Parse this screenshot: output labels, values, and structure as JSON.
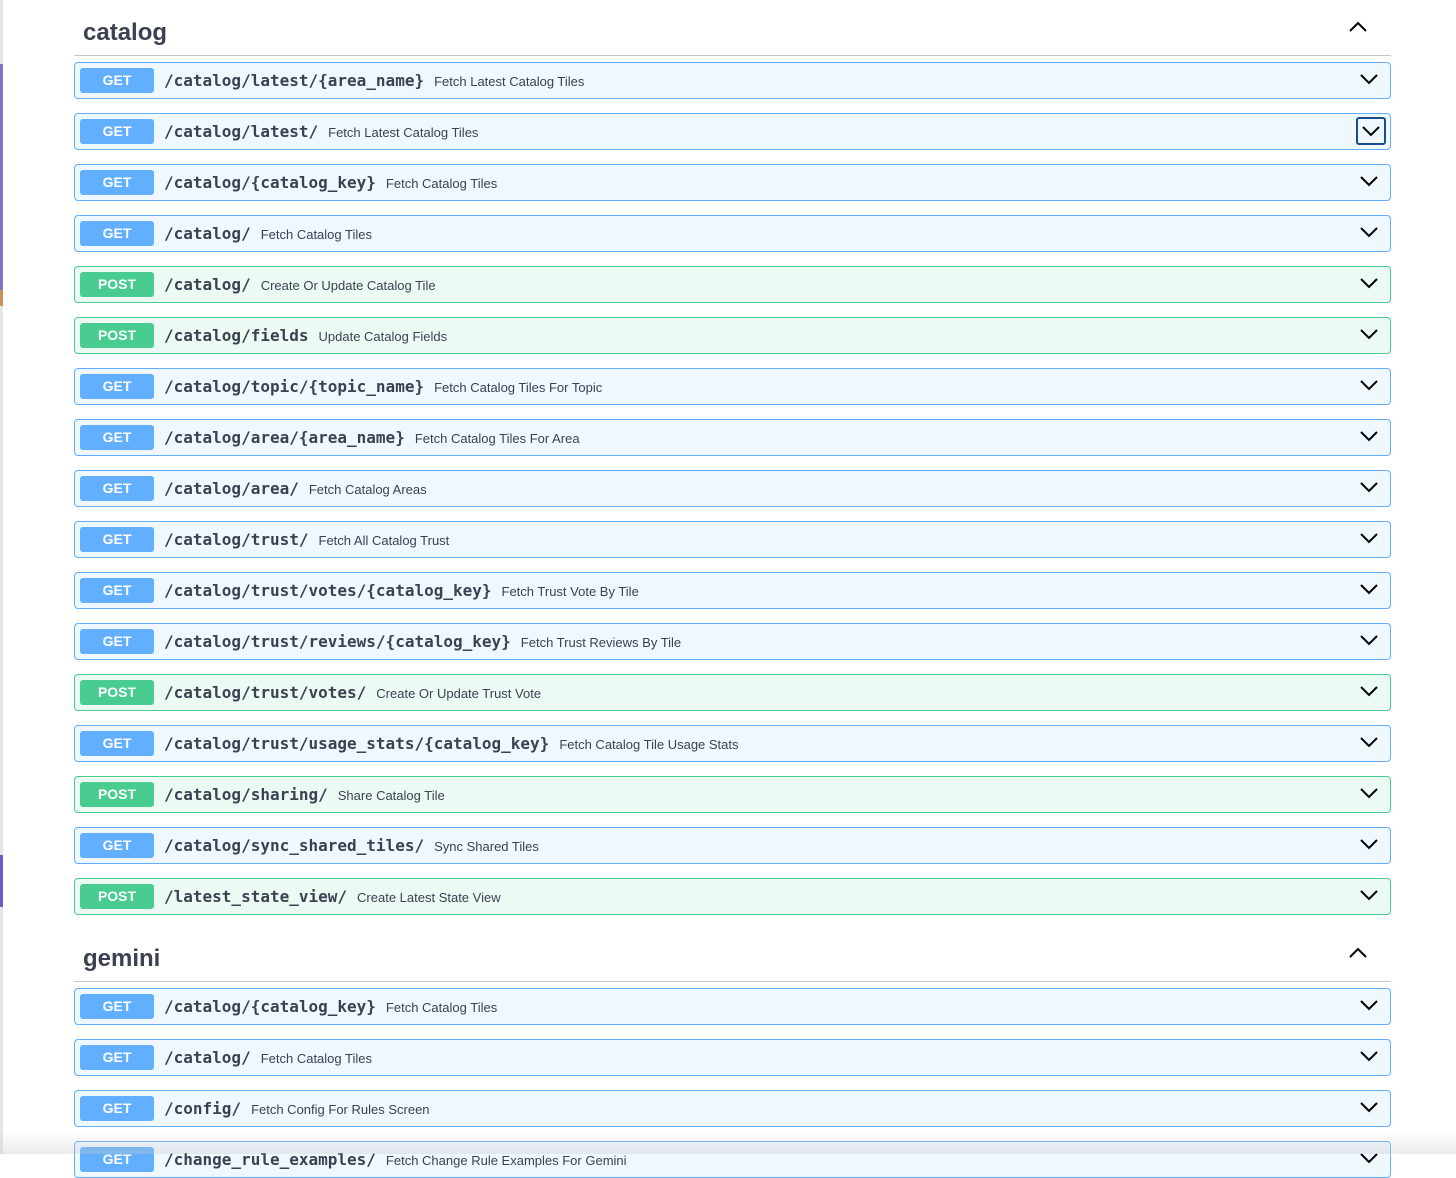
{
  "sections": [
    {
      "title": "catalog",
      "collapse_icon": "chevron-up-icon",
      "operations": [
        {
          "method": "GET",
          "path": "/catalog/latest/{area_name}",
          "summary": "Fetch Latest Catalog Tiles"
        },
        {
          "method": "GET",
          "path": "/catalog/latest/",
          "summary": "Fetch Latest Catalog Tiles",
          "focused": true
        },
        {
          "method": "GET",
          "path": "/catalog/{catalog_key}",
          "summary": "Fetch Catalog Tiles"
        },
        {
          "method": "GET",
          "path": "/catalog/",
          "summary": "Fetch Catalog Tiles"
        },
        {
          "method": "POST",
          "path": "/catalog/",
          "summary": "Create Or Update Catalog Tile"
        },
        {
          "method": "POST",
          "path": "/catalog/fields",
          "summary": "Update Catalog Fields"
        },
        {
          "method": "GET",
          "path": "/catalog/topic/{topic_name}",
          "summary": "Fetch Catalog Tiles For Topic"
        },
        {
          "method": "GET",
          "path": "/catalog/area/{area_name}",
          "summary": "Fetch Catalog Tiles For Area"
        },
        {
          "method": "GET",
          "path": "/catalog/area/",
          "summary": "Fetch Catalog Areas"
        },
        {
          "method": "GET",
          "path": "/catalog/trust/",
          "summary": "Fetch All Catalog Trust"
        },
        {
          "method": "GET",
          "path": "/catalog/trust/votes/{catalog_key}",
          "summary": "Fetch Trust Vote By Tile"
        },
        {
          "method": "GET",
          "path": "/catalog/trust/reviews/{catalog_key}",
          "summary": "Fetch Trust Reviews By Tile"
        },
        {
          "method": "POST",
          "path": "/catalog/trust/votes/",
          "summary": "Create Or Update Trust Vote"
        },
        {
          "method": "GET",
          "path": "/catalog/trust/usage_stats/{catalog_key}",
          "summary": "Fetch Catalog Tile Usage Stats"
        },
        {
          "method": "POST",
          "path": "/catalog/sharing/",
          "summary": "Share Catalog Tile"
        },
        {
          "method": "GET",
          "path": "/catalog/sync_shared_tiles/",
          "summary": "Sync Shared Tiles"
        },
        {
          "method": "POST",
          "path": "/latest_state_view/",
          "summary": "Create Latest State View"
        }
      ]
    },
    {
      "title": "gemini",
      "collapse_icon": "chevron-up-icon",
      "operations": [
        {
          "method": "GET",
          "path": "/catalog/{catalog_key}",
          "summary": "Fetch Catalog Tiles"
        },
        {
          "method": "GET",
          "path": "/catalog/",
          "summary": "Fetch Catalog Tiles"
        },
        {
          "method": "GET",
          "path": "/config/",
          "summary": "Fetch Config For Rules Screen"
        },
        {
          "method": "GET",
          "path": "/change_rule_examples/",
          "summary": "Fetch Change Rule Examples For Gemini"
        }
      ]
    }
  ],
  "colors": {
    "get": "#61affe",
    "post": "#49cc90",
    "text": "#3b4151",
    "focus_border": "#1a4c8b"
  },
  "icons": {
    "expand": "chevron-down-icon",
    "collapse": "chevron-up-icon"
  }
}
